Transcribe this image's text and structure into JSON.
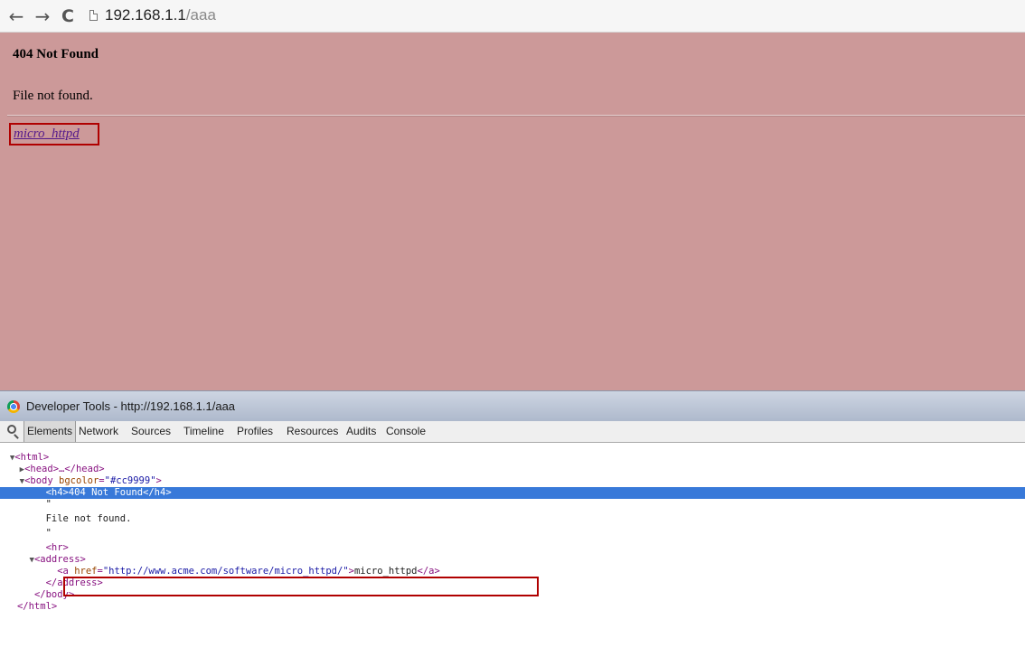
{
  "browser": {
    "url_host": "192.168.1.1",
    "url_path": "/aaa",
    "icons": {
      "back": "back-arrow-icon",
      "forward": "forward-arrow-icon",
      "reload": "reload-icon",
      "page": "page-icon"
    }
  },
  "page": {
    "heading": "404 Not Found",
    "message": "File not found.",
    "server_link": "micro_httpd",
    "background": "#cc9999"
  },
  "devtools": {
    "title": "Developer Tools - http://192.168.1.1/aaa",
    "tabs": [
      "Elements",
      "Network",
      "Sources",
      "Timeline",
      "Profiles",
      "Resources",
      "Audits",
      "Console"
    ],
    "active_tab": "Elements",
    "tree": {
      "html_open": "<html>",
      "head": "<head>…</head>",
      "body_tag": "<body ",
      "body_attr": "bgcolor",
      "body_val": "\"#cc9999\"",
      "h4_line": "<h4>404 Not Found</h4>",
      "quote": "\"",
      "text": "File not found.",
      "hr": "<hr>",
      "address_open": "<address>",
      "a_tag": "<a ",
      "a_attr": "href",
      "a_val": "\"http://www.acme.com/software/micro_httpd/\"",
      "a_text": "micro_httpd",
      "a_close": "</a>",
      "address_close": "</address>",
      "body_close": "</body>",
      "html_close": "</html>"
    }
  }
}
